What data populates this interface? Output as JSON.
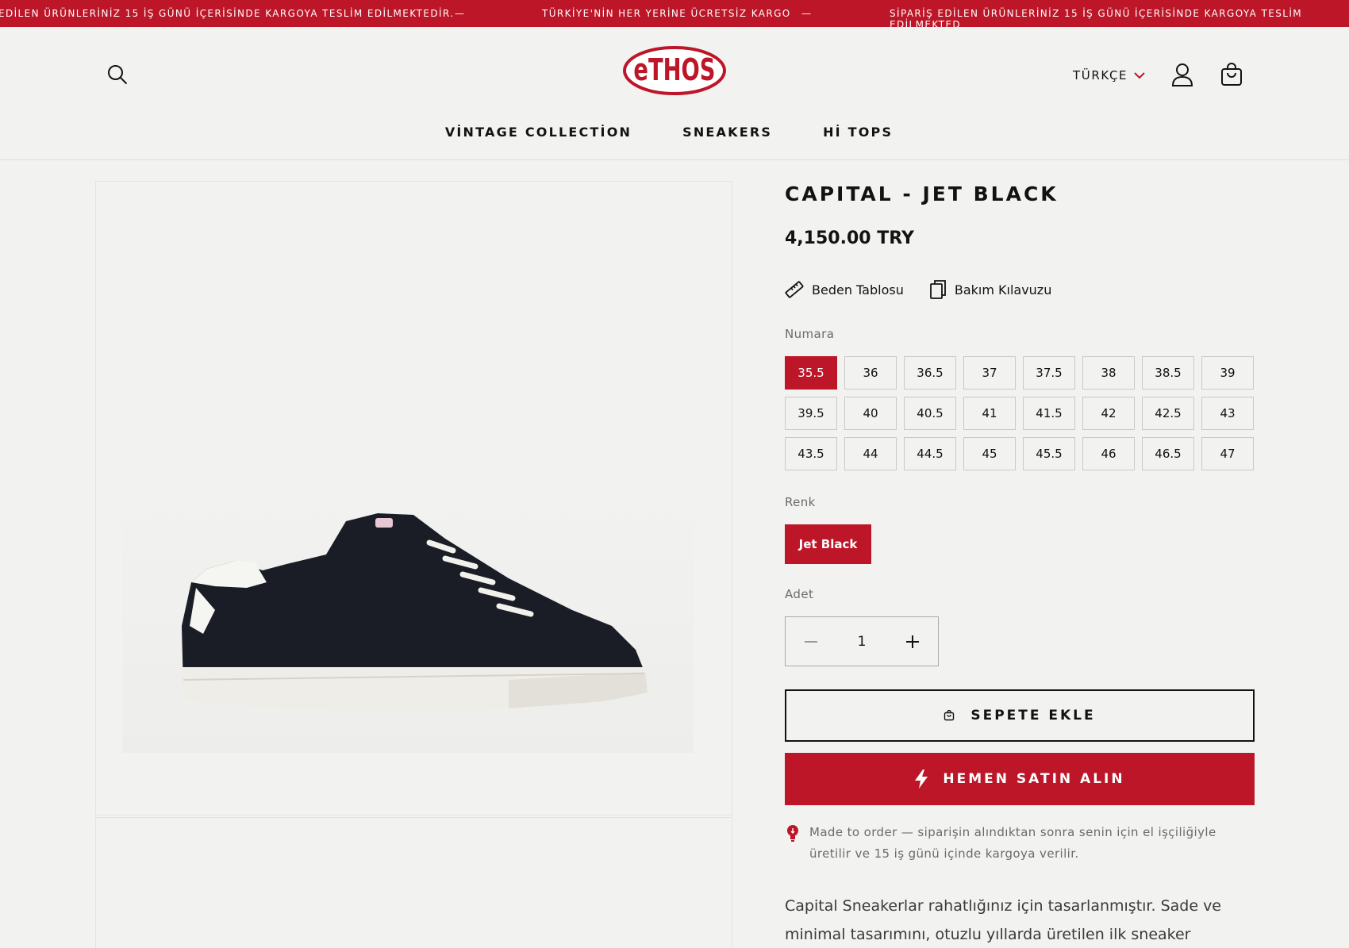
{
  "colors": {
    "brand_red": "#bd1628",
    "background": "#f2f2f0",
    "text": "#121212",
    "muted": "#6b6b6b"
  },
  "announcement": {
    "message_1": "EDİLEN ÜRÜNLERİNİZ 15 İŞ GÜNÜ İÇERİSİNDE KARGOYA TESLİM EDİLMEKTEDİR.",
    "separator": "—",
    "message_2": "TÜRKİYE'NİN HER YERİNE ÜCRETSİZ KARGO",
    "message_3": "SİPARİŞ EDİLEN ÜRÜNLERİNİZ 15 İŞ GÜNÜ İÇERİSİNDE KARGOYA TESLİM EDİLMEKTED"
  },
  "header": {
    "logo_text": "eTHOS",
    "language": "TÜRKÇE",
    "icons": {
      "search": "search-icon",
      "language_chevron": "chevron-down-icon",
      "account": "user-icon",
      "cart": "shopping-bag-icon"
    }
  },
  "nav": {
    "items": [
      "VİNTAGE COLLECTİON",
      "SNEAKERS",
      "Hİ TOPS"
    ]
  },
  "product": {
    "title": "CAPITAL - JET BLACK",
    "price": "4,150.00 TRY",
    "guides": [
      {
        "label": "Beden Tablosu",
        "icon": "ruler-icon"
      },
      {
        "label": "Bakım Kılavuzu",
        "icon": "document-copy-icon"
      }
    ],
    "size_label": "Numara",
    "sizes": [
      "35.5",
      "36",
      "36.5",
      "37",
      "37.5",
      "38",
      "38.5",
      "39",
      "39.5",
      "40",
      "40.5",
      "41",
      "41.5",
      "42",
      "42.5",
      "43",
      "43.5",
      "44",
      "44.5",
      "45",
      "45.5",
      "46",
      "46.5",
      "47"
    ],
    "selected_size": "35.5",
    "color_label": "Renk",
    "color_value": "Jet Black",
    "quantity_label": "Adet",
    "quantity": "1",
    "add_to_cart": "SEPETE EKLE",
    "buy_now": "HEMEN SATIN ALIN",
    "notice_line_1": "Made to order — siparişin alındıktan sonra senin için el işçiliğiyle",
    "notice_line_2": "üretilir ve 15 iş günü içinde kargoya verilir.",
    "description_line_1": "Capital Sneakerlar rahatlığınız için tasarlanmıştır. Sade ve",
    "description_line_2": "minimal tasarımını, otuzlu yıllarda üretilen ilk sneaker"
  }
}
